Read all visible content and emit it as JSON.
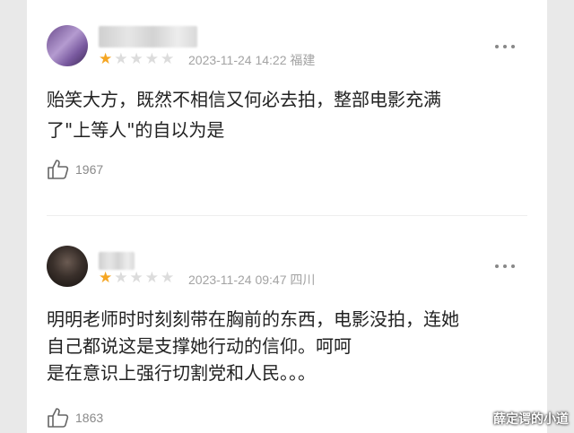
{
  "comments": [
    {
      "rating": 1,
      "max_rating": 5,
      "date": "2023-11-24 14:22",
      "location": "福建",
      "text": "贻笑大方，既然不相信又何必去拍，整部电影充满\n了\"上等人\"的自以为是",
      "likes": "1967"
    },
    {
      "rating": 1,
      "max_rating": 5,
      "date": "2023-11-24 09:47",
      "location": "四川",
      "text": "明明老师时时刻刻带在胸前的东西，电影没拍，连她\n自己都说这是支撑她行动的信仰。呵呵\n是在意识上强行切割党和人民。。。",
      "likes": "1863"
    }
  ],
  "icons": {
    "more": "more-dots-icon",
    "like": "thumbs-up-icon",
    "star": "star-icon"
  },
  "colors": {
    "star_on": "#f5a623",
    "star_off": "#dcdcdc",
    "meta": "#a3a3a3"
  },
  "watermark": "薛定谔的小道"
}
